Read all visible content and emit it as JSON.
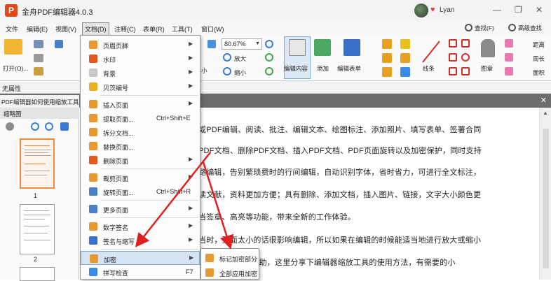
{
  "window": {
    "title": "金舟PDF编辑器4.0.3",
    "user": "Lyan",
    "minimize": "—",
    "restore": "❐",
    "close": "✕"
  },
  "menubar": [
    "文件",
    "编辑(E)",
    "视图(V)",
    "文档(D)",
    "注释(C)",
    "表单(R)",
    "工具(T)",
    "窗口(W)"
  ],
  "ribbon": {
    "open_label": "打开(O)...",
    "zoom_value": "80.67%",
    "zoom_in": "放大",
    "zoom_out": "缩小",
    "edit_content": "编辑内容",
    "add": "添加",
    "edit_form": "编辑表单",
    "line": "线条",
    "stamp": "图章",
    "find": "查找(F)",
    "adv_search": "高级查找",
    "distance": "距离",
    "perimeter": "周长",
    "area": "面积",
    "partial_small": "小"
  },
  "property_bar": "无属性",
  "tab": {
    "name": "PDF编辑器如何使用缩放工具.pdf",
    "close": "✕"
  },
  "thumbnails": {
    "header": "缩略图",
    "pages": [
      "1",
      "2"
    ]
  },
  "dropdown": {
    "items": [
      {
        "label": "页眉页脚",
        "shortcut": "",
        "submenu": true
      },
      {
        "label": "水印",
        "shortcut": "",
        "submenu": true
      },
      {
        "label": "背景",
        "shortcut": "",
        "submenu": true
      },
      {
        "label": "贝茨编号",
        "shortcut": "",
        "submenu": true
      },
      {
        "label": "插入页面",
        "shortcut": "",
        "submenu": true
      },
      {
        "label": "提取页面...",
        "shortcut": "Ctrl+Shift+E",
        "submenu": false
      },
      {
        "label": "拆分文档...",
        "shortcut": "",
        "submenu": false
      },
      {
        "label": "替换页面...",
        "shortcut": "",
        "submenu": false
      },
      {
        "label": "删除页面",
        "shortcut": "",
        "submenu": true
      },
      {
        "label": "裁剪页面",
        "shortcut": "",
        "submenu": true
      },
      {
        "label": "旋转页面...",
        "shortcut": "Ctrl+Shift+R",
        "submenu": false
      },
      {
        "label": "更多页面",
        "shortcut": "",
        "submenu": true
      },
      {
        "label": "数字签名",
        "shortcut": "",
        "submenu": true
      },
      {
        "label": "签名与缩写",
        "shortcut": "",
        "submenu": true
      },
      {
        "label": "加密",
        "shortcut": "",
        "submenu": true
      },
      {
        "label": "拼写检查",
        "shortcut": "F7",
        "submenu": false
      }
    ],
    "arrow": "▶"
  },
  "submenu": {
    "items": [
      "标记加密部分",
      "全部应用加密"
    ]
  },
  "document": {
    "lines": [
      "或PDF编辑、阅读、批注、编辑文本、绘图标注、添加照片、填写表单、签署合同",
      "PDF文档、删除PDF文档、插入PDF文档、PDF页面旋转以及加密保护，同时支持",
      "路编辑，告别繁琐费时的行间编辑，自动识别字体，省时省力，可进行全文标注，",
      "读文献，资料更加方便；具有删除、添加文档，插入图片、链接，文字大小颜色更",
      "当签章、高亮等功能，带来全新的工作体验。",
      "当时，页面太小的话很影响编辑，所以如果在编辑的时候能适当地进行放大或缩小",
      "少的帮助，这里分享下编辑器缩放工具的使用方法，有需要的小"
    ]
  },
  "colors": {
    "accent": "#e0481a",
    "arrow": "#e02020",
    "highlight": "#d6e3f3"
  }
}
